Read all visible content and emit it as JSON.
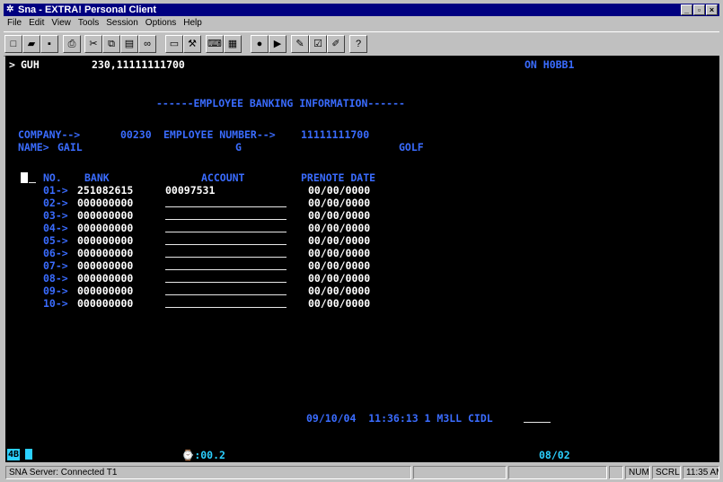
{
  "window": {
    "title": "Sna - EXTRA! Personal Client"
  },
  "menu": [
    "File",
    "Edit",
    "View",
    "Tools",
    "Session",
    "Options",
    "Help"
  ],
  "toolbar_icons": [
    "new-icon",
    "open-icon",
    "save-icon",
    "print-icon",
    "cut-icon",
    "copy-icon",
    "paste-icon",
    "macro-icon",
    "folder-icon",
    "tools-icon",
    "keyboard-icon",
    "quickpad-icon",
    "record-icon",
    "play-icon",
    "edit-icon",
    "checkbox-icon",
    "pencil-icon",
    "whats-this-icon"
  ],
  "terminal": {
    "line1": {
      "prompt": ">",
      "command": "GUH",
      "args": "230,11111111700",
      "right": "ON H0BB1"
    },
    "heading": "------EMPLOYEE BANKING INFORMATION------",
    "company_label": "COMPANY-->",
    "company_value": "00230",
    "employee_label": "EMPLOYEE NUMBER-->",
    "employee_value": "11111111700",
    "name_label": "NAME>",
    "first_name": "GAIL",
    "middle_initial": "G",
    "last_name": "GOLF",
    "headers": {
      "no": "NO.",
      "bank": "BANK",
      "account": "ACCOUNT",
      "prenote": "PRENOTE DATE"
    },
    "rows": [
      {
        "no": "01->",
        "bank": "251082615",
        "account": "00097531",
        "date": "00/00/0000"
      },
      {
        "no": "02->",
        "bank": "000000000",
        "account": "",
        "date": "00/00/0000"
      },
      {
        "no": "03->",
        "bank": "000000000",
        "account": "",
        "date": "00/00/0000"
      },
      {
        "no": "04->",
        "bank": "000000000",
        "account": "",
        "date": "00/00/0000"
      },
      {
        "no": "05->",
        "bank": "000000000",
        "account": "",
        "date": "00/00/0000"
      },
      {
        "no": "06->",
        "bank": "000000000",
        "account": "",
        "date": "00/00/0000"
      },
      {
        "no": "07->",
        "bank": "000000000",
        "account": "",
        "date": "00/00/0000"
      },
      {
        "no": "08->",
        "bank": "000000000",
        "account": "",
        "date": "00/00/0000"
      },
      {
        "no": "09->",
        "bank": "000000000",
        "account": "",
        "date": "00/00/0000"
      },
      {
        "no": "10->",
        "bank": "000000000",
        "account": "",
        "date": "00/00/0000"
      }
    ],
    "footer": "09/10/04  11:36:13 1 M3LL CIDL"
  },
  "oia": {
    "left": "4B",
    "center": "⌚:00.2",
    "right": "08/02"
  },
  "statusbar": {
    "server": "SNA Server: Connected T1",
    "num": "NUM",
    "scrl": "SCRL",
    "time": "11:35 AM"
  },
  "colors": {
    "field_text": "#3a6cff",
    "input_text": "#ffffff",
    "status_text": "#2bd0ff",
    "title_bar": "#000080"
  }
}
